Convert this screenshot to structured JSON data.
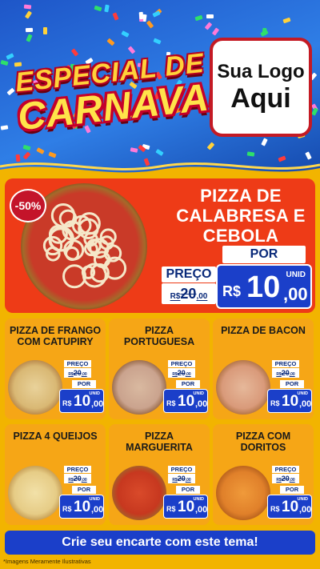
{
  "header": {
    "title_line1": "ESPECIAL DE",
    "title_line2": "CARNAVAL",
    "logo_line1": "Sua Logo",
    "logo_line2": "Aqui"
  },
  "featured": {
    "discount_badge": "-50%",
    "name": "PIZZA DE CALABRESA E CEBOLA",
    "preco_label": "PREÇO",
    "old_currency": "R$",
    "old_int": "20",
    "old_dec": ",00",
    "por_label": "POR",
    "unid_label": "UNID",
    "new_currency": "R$",
    "new_int": "10",
    "new_dec": ",00"
  },
  "products": [
    {
      "name": "PIZZA DE FRANGO COM CATUPIRY",
      "preco_label": "PREÇO",
      "old_currency": "R$",
      "old_int": "20",
      "old_dec": ",00",
      "por_label": "POR",
      "unid_label": "UNID",
      "new_currency": "R$",
      "new_int": "10",
      "new_dec": ",00"
    },
    {
      "name": "PIZZA PORTUGUESA",
      "preco_label": "PREÇO",
      "old_currency": "R$",
      "old_int": "20",
      "old_dec": ",00",
      "por_label": "POR",
      "unid_label": "UNID",
      "new_currency": "R$",
      "new_int": "10",
      "new_dec": ",00"
    },
    {
      "name": "PIZZA DE BACON",
      "preco_label": "PREÇO",
      "old_currency": "R$",
      "old_int": "20",
      "old_dec": ",00",
      "por_label": "POR",
      "unid_label": "UNID",
      "new_currency": "R$",
      "new_int": "10",
      "new_dec": ",00"
    },
    {
      "name": "PIZZA 4 QUEIJOS",
      "preco_label": "PREÇO",
      "old_currency": "R$",
      "old_int": "20",
      "old_dec": ",00",
      "por_label": "POR",
      "unid_label": "UNID",
      "new_currency": "R$",
      "new_int": "10",
      "new_dec": ",00"
    },
    {
      "name": "PIZZA MARGUERITA",
      "preco_label": "PREÇO",
      "old_currency": "R$",
      "old_int": "20",
      "old_dec": ",00",
      "por_label": "POR",
      "unid_label": "UNID",
      "new_currency": "R$",
      "new_int": "10",
      "new_dec": ",00"
    },
    {
      "name": "PIZZA COM DORITOS",
      "preco_label": "PREÇO",
      "old_currency": "R$",
      "old_int": "20",
      "old_dec": ",00",
      "por_label": "POR",
      "unid_label": "UNID",
      "new_currency": "R$",
      "new_int": "10",
      "new_dec": ",00"
    }
  ],
  "cta": {
    "label": "Crie seu encarte com este tema!"
  },
  "footer": {
    "disclaimer": "*Imagens Meramente Ilustrativas"
  },
  "colors": {
    "background_yellow": "#f2b400",
    "sky_blue": "#2f7ee6",
    "featured_red": "#ee3b17",
    "card_orange": "#f6a616",
    "price_blue": "#1b3fc9",
    "badge_red": "#c4142a"
  }
}
